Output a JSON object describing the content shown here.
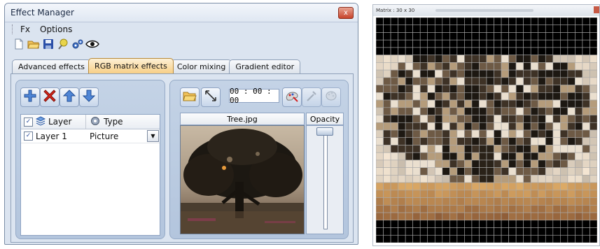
{
  "effect_manager": {
    "title": "Effect Manager",
    "close_glyph": "x",
    "menu": [
      "Fx",
      "Options"
    ],
    "toolbar_icons": [
      "new-file-icon",
      "open-folder-icon",
      "save-icon",
      "balloon-icon",
      "gears-icon",
      "eye-icon"
    ],
    "tabs": [
      {
        "label": "Advanced effects",
        "active": false
      },
      {
        "label": "RGB matrix effects",
        "active": true
      },
      {
        "label": "Color mixing",
        "active": false
      },
      {
        "label": "Gradient editor",
        "active": false
      }
    ],
    "layer_buttons": [
      "add-layer-icon",
      "delete-layer-icon",
      "move-up-icon",
      "move-down-icon"
    ],
    "layer_table": {
      "col_layer": "Layer",
      "col_type": "Type",
      "rows": [
        {
          "checked": true,
          "layer": "Layer 1",
          "type": "Picture"
        }
      ]
    },
    "picture_tools": [
      "open-picture-icon",
      "resize-icon",
      "color-picker-icon",
      "eyedropper-icon",
      "palette-icon"
    ],
    "time": "00 : 00 : 00",
    "picture_title": "Tree.jpg",
    "opacity_label": "Opacity",
    "opacity_level": 1.0
  },
  "matrix_window": {
    "title": "Matrix : 30 x 30",
    "rows": 30,
    "cols": 30
  },
  "colors": {
    "tab_active": "#f7cf86",
    "panel_bg": "#dbe4f0",
    "matrix_grid": "#a9a9a9"
  }
}
